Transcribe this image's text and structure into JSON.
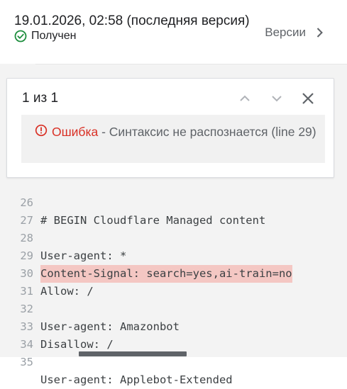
{
  "header": {
    "version_title": "19.01.2026, 02:58 (последняя версия)",
    "status_label": "Получен",
    "status_icon": "check-circle-icon",
    "versions_label": "Версии"
  },
  "error_panel": {
    "counter": "1 из 1",
    "message_type": "Ошибка",
    "message_separator": " - ",
    "message_text": "Синтаксис не распознается (line 29)"
  },
  "colors": {
    "success": "#1e8e3e",
    "error": "#d93025",
    "error_line_highlight": "#f4c7c3"
  },
  "code_lines": [
    {
      "num": "26",
      "text": "# BEGIN Cloudflare Managed content",
      "error": false
    },
    {
      "num": "27",
      "text": "",
      "error": false
    },
    {
      "num": "28",
      "text": "User-agent: *",
      "error": false
    },
    {
      "num": "29",
      "text": "Content-Signal: search=yes,ai-train=no",
      "error": true
    },
    {
      "num": "30",
      "text": "Allow: /",
      "error": false
    },
    {
      "num": "31",
      "text": "",
      "error": false
    },
    {
      "num": "32",
      "text": "User-agent: Amazonbot",
      "error": false
    },
    {
      "num": "33",
      "text": "Disallow: /",
      "error": false
    },
    {
      "num": "34",
      "text": "",
      "error": false
    },
    {
      "num": "35",
      "text": "User-agent: Applebot-Extended",
      "error": false
    }
  ]
}
